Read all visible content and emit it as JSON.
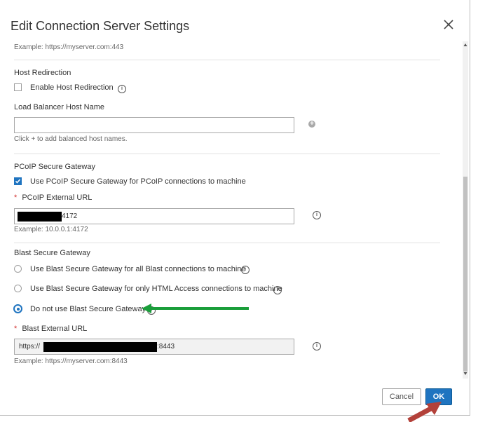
{
  "dialog": {
    "title": "Edit Connection Server Settings",
    "close_icon": "close-icon"
  },
  "top_example": "Example: https://myserver.com:443",
  "host_redirection": {
    "section_title": "Host Redirection",
    "enable_label": "Enable Host Redirection",
    "enabled": false,
    "lb_label": "Load Balancer Host Name",
    "lb_value": "",
    "lb_hint": "Click + to add balanced host names."
  },
  "pcoip": {
    "section_title": "PCoIP Secure Gateway",
    "use_label": "Use PCoIP Secure Gateway for PCoIP connections to machine",
    "use_checked": true,
    "url_label": "PCoIP External URL",
    "url_visible_suffix": "4172",
    "url_example": "Example: 10.0.0.1:4172"
  },
  "blast": {
    "section_title": "Blast Secure Gateway",
    "options": [
      {
        "label": "Use Blast Secure Gateway for all Blast connections to machine",
        "selected": false
      },
      {
        "label": "Use Blast Secure Gateway for only HTML Access connections to machine",
        "selected": false
      },
      {
        "label": "Do not use Blast Secure Gateway",
        "selected": true
      }
    ],
    "url_label": "Blast External URL",
    "url_prefix": "https://",
    "url_suffix": ":8443",
    "url_example": "Example: https://myserver.com:8443"
  },
  "required_marker": "*",
  "footer": {
    "cancel_label": "Cancel",
    "ok_label": "OK"
  },
  "colors": {
    "accent": "#1f74c0",
    "annotation_green": "#1a9e3a",
    "annotation_red": "#b3413a"
  }
}
